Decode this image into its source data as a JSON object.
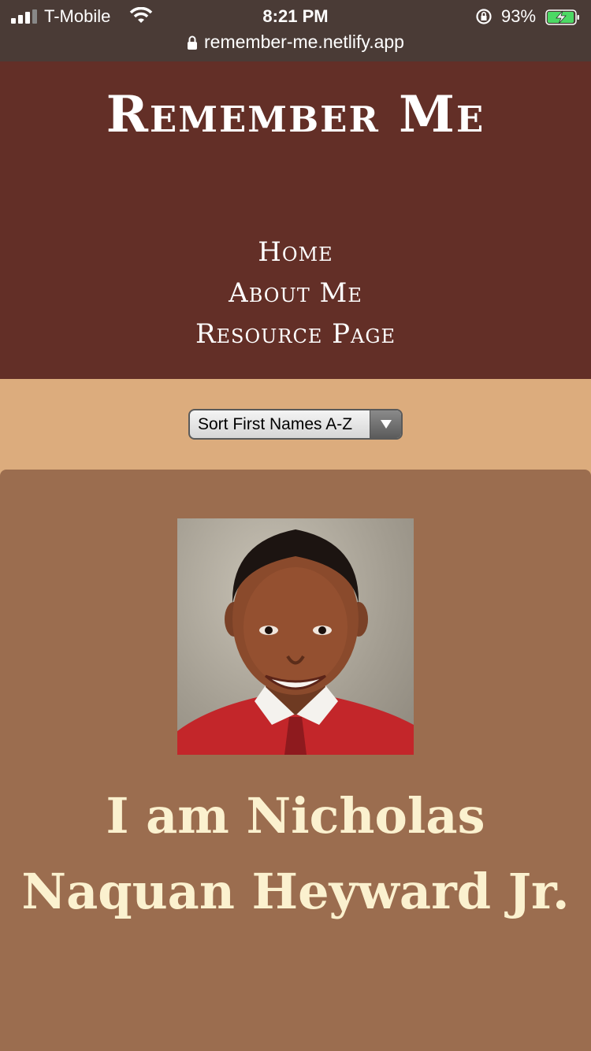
{
  "status_bar": {
    "carrier": "T-Mobile",
    "time": "8:21 PM",
    "battery_percent": "93%",
    "url": "remember-me.netlify.app",
    "icons": [
      "signal-icon",
      "wifi-icon",
      "rotation-lock-icon",
      "battery-charging-icon",
      "padlock-icon"
    ]
  },
  "header": {
    "title": "Remember Me",
    "nav": [
      {
        "label": "Home"
      },
      {
        "label": "About Me"
      },
      {
        "label": "Resource Page"
      }
    ]
  },
  "sort": {
    "selected": "Sort First Names A-Z"
  },
  "card": {
    "name": "I am Nicholas Naquan Heyward Jr."
  },
  "colors": {
    "header_bg": "#632f27",
    "page_bg": "#dcac7d",
    "card_bg": "#9b6d4f",
    "name_text": "#fbf1cf"
  }
}
